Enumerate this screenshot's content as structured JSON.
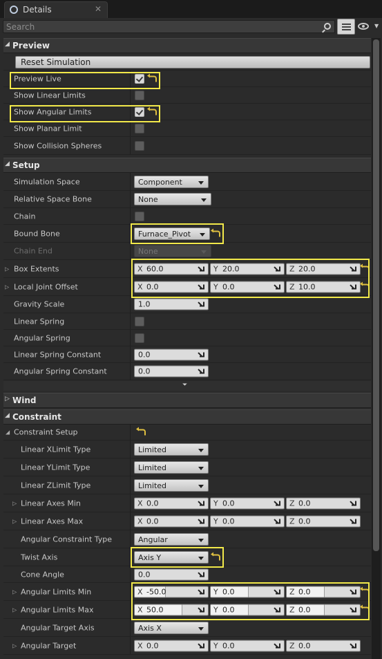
{
  "tab": {
    "title": "Details",
    "close": "✕",
    "icon": "details-icon"
  },
  "search": {
    "placeholder": "Search",
    "value": ""
  },
  "colors": {
    "highlight": "#f2e94a",
    "panel": "#2b2b2b",
    "header": "#373737"
  },
  "sections": {
    "preview": {
      "title": "Preview",
      "reset_button": "Reset Simulation",
      "preview_live": {
        "label": "Preview Live",
        "checked": true
      },
      "show_linear_limits": {
        "label": "Show Linear Limits",
        "checked": false
      },
      "show_angular_limits": {
        "label": "Show Angular Limits",
        "checked": true
      },
      "show_planar_limit": {
        "label": "Show Planar Limit",
        "checked": false
      },
      "show_collision_spheres": {
        "label": "Show Collision Spheres",
        "checked": false
      }
    },
    "setup": {
      "title": "Setup",
      "simulation_space": {
        "label": "Simulation Space",
        "value": "Component"
      },
      "relative_space_bone": {
        "label": "Relative Space Bone",
        "value": "None"
      },
      "chain": {
        "label": "Chain",
        "checked": false
      },
      "bound_bone": {
        "label": "Bound Bone",
        "value": "Furnace_Pivot"
      },
      "chain_end": {
        "label": "Chain End",
        "value": "None"
      },
      "box_extents": {
        "label": "Box Extents",
        "x": "60.0",
        "y": "20.0",
        "z": "20.0"
      },
      "local_joint_offset": {
        "label": "Local Joint Offset",
        "x": "0.0",
        "y": "0.0",
        "z": "10.0"
      },
      "gravity_scale": {
        "label": "Gravity Scale",
        "value": "1.0"
      },
      "linear_spring": {
        "label": "Linear Spring",
        "checked": false
      },
      "angular_spring": {
        "label": "Angular Spring",
        "checked": false
      },
      "linear_spring_constant": {
        "label": "Linear Spring Constant",
        "value": "0.0"
      },
      "angular_spring_constant": {
        "label": "Angular Spring Constant",
        "value": "0.0"
      }
    },
    "wind": {
      "title": "Wind"
    },
    "constraint": {
      "title": "Constraint",
      "constraint_setup": {
        "label": "Constraint Setup"
      },
      "linear_xlimit_type": {
        "label": "Linear XLimit Type",
        "value": "Limited"
      },
      "linear_ylimit_type": {
        "label": "Linear YLimit Type",
        "value": "Limited"
      },
      "linear_zlimit_type": {
        "label": "Linear ZLimit Type",
        "value": "Limited"
      },
      "linear_axes_min": {
        "label": "Linear Axes Min",
        "x": "0.0",
        "y": "0.0",
        "z": "0.0"
      },
      "linear_axes_max": {
        "label": "Linear Axes Max",
        "x": "0.0",
        "y": "0.0",
        "z": "0.0"
      },
      "angular_constraint_type": {
        "label": "Angular Constraint Type",
        "value": "Angular"
      },
      "twist_axis": {
        "label": "Twist Axis",
        "value": "Axis Y"
      },
      "cone_angle": {
        "label": "Cone Angle",
        "value": "0.0"
      },
      "angular_limits_min": {
        "label": "Angular Limits Min",
        "x": "-50.0",
        "y": "0.0",
        "z": "0.0",
        "x_fill": 0.42,
        "y_fill": 0.52,
        "z_fill": 0.52
      },
      "angular_limits_max": {
        "label": "Angular Limits Max",
        "x": "50.0",
        "y": "0.0",
        "z": "0.0",
        "x_fill": 0.65,
        "y_fill": 0.52,
        "z_fill": 0.52
      },
      "angular_target_axis": {
        "label": "Angular Target Axis",
        "value": "Axis X"
      },
      "angular_target": {
        "label": "Angular Target",
        "x": "0.0",
        "y": "0.0",
        "z": "0.0"
      }
    }
  },
  "axis_labels": {
    "x": "X",
    "y": "Y",
    "z": "Z"
  }
}
